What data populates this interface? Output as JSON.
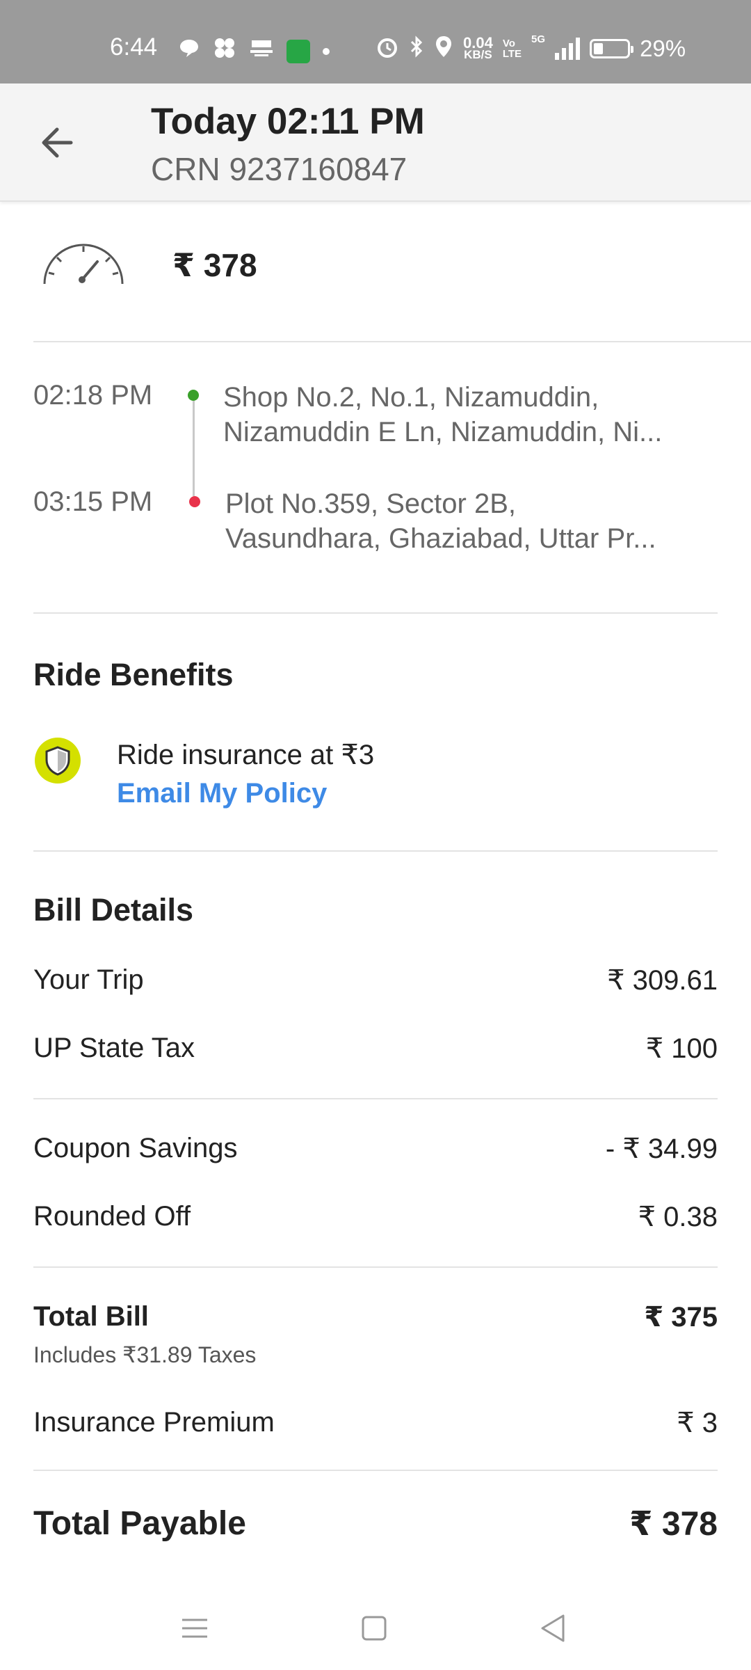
{
  "status_bar": {
    "time": "6:44",
    "net_speed_value": "0.04",
    "net_speed_unit": "KB/S",
    "volte_top": "Vo",
    "volte_bottom": "LTE",
    "network": "5G",
    "battery_percent": "29%",
    "battery_level": 0.29
  },
  "header": {
    "title": "Today 02:11 PM",
    "crn": "CRN 9237160847"
  },
  "fare": {
    "amount": "₹ 378"
  },
  "route": {
    "pickup": {
      "time": "02:18 PM",
      "address_line1": "Shop No.2, No.1, Nizamuddin,",
      "address_line2": "Nizamuddin E Ln, Nizamuddin, Ni..."
    },
    "drop": {
      "time": "03:15 PM",
      "address_line1": "Plot No.359, Sector 2B,",
      "address_line2": "Vasundhara, Ghaziabad, Uttar Pr..."
    }
  },
  "benefits": {
    "title": "Ride Benefits",
    "insurance_text": "Ride insurance at ₹3",
    "email_link": "Email My Policy"
  },
  "bill": {
    "title": "Bill Details",
    "your_trip_label": "Your Trip",
    "your_trip_value": "₹ 309.61",
    "state_tax_label": "UP State Tax",
    "state_tax_value": "₹ 100",
    "coupon_label": "Coupon Savings",
    "coupon_value": "- ₹ 34.99",
    "rounded_label": "Rounded Off",
    "rounded_value": "₹ 0.38",
    "total_bill_label": "Total Bill",
    "total_bill_value": "₹ 375",
    "taxes_note": "Includes ₹31.89 Taxes",
    "insurance_label": "Insurance Premium",
    "insurance_value": "₹ 3",
    "total_payable_label": "Total Payable",
    "total_payable_value": "₹ 378"
  },
  "colors": {
    "status_bar": "#9b9b9b",
    "header_bg": "#f4f4f4",
    "link_blue": "#3e8ae6",
    "pickup_green": "#3aa02a",
    "drop_red": "#e8324a",
    "shield_badge": "#d4e000"
  }
}
